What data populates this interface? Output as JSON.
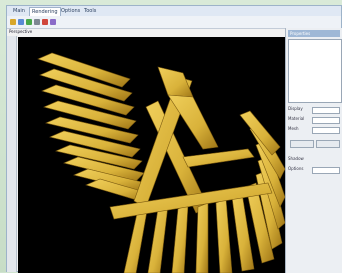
{
  "window": {
    "menu_tabs": [
      {
        "label": "Main"
      },
      {
        "label": "Rendering"
      },
      {
        "label": "Options"
      },
      {
        "label": "Tools"
      }
    ],
    "viewport_label": "Perspective"
  },
  "right_panel": {
    "title": "Properties",
    "rows": [
      {
        "label": "Display"
      },
      {
        "label": "Material"
      },
      {
        "label": "Mesh"
      },
      {
        "label": "Shadow"
      },
      {
        "label": "Options"
      }
    ]
  },
  "colors": {
    "viewport_bg": "#000000",
    "model": "#d9b23a",
    "model_shadow": "#a37b19"
  }
}
